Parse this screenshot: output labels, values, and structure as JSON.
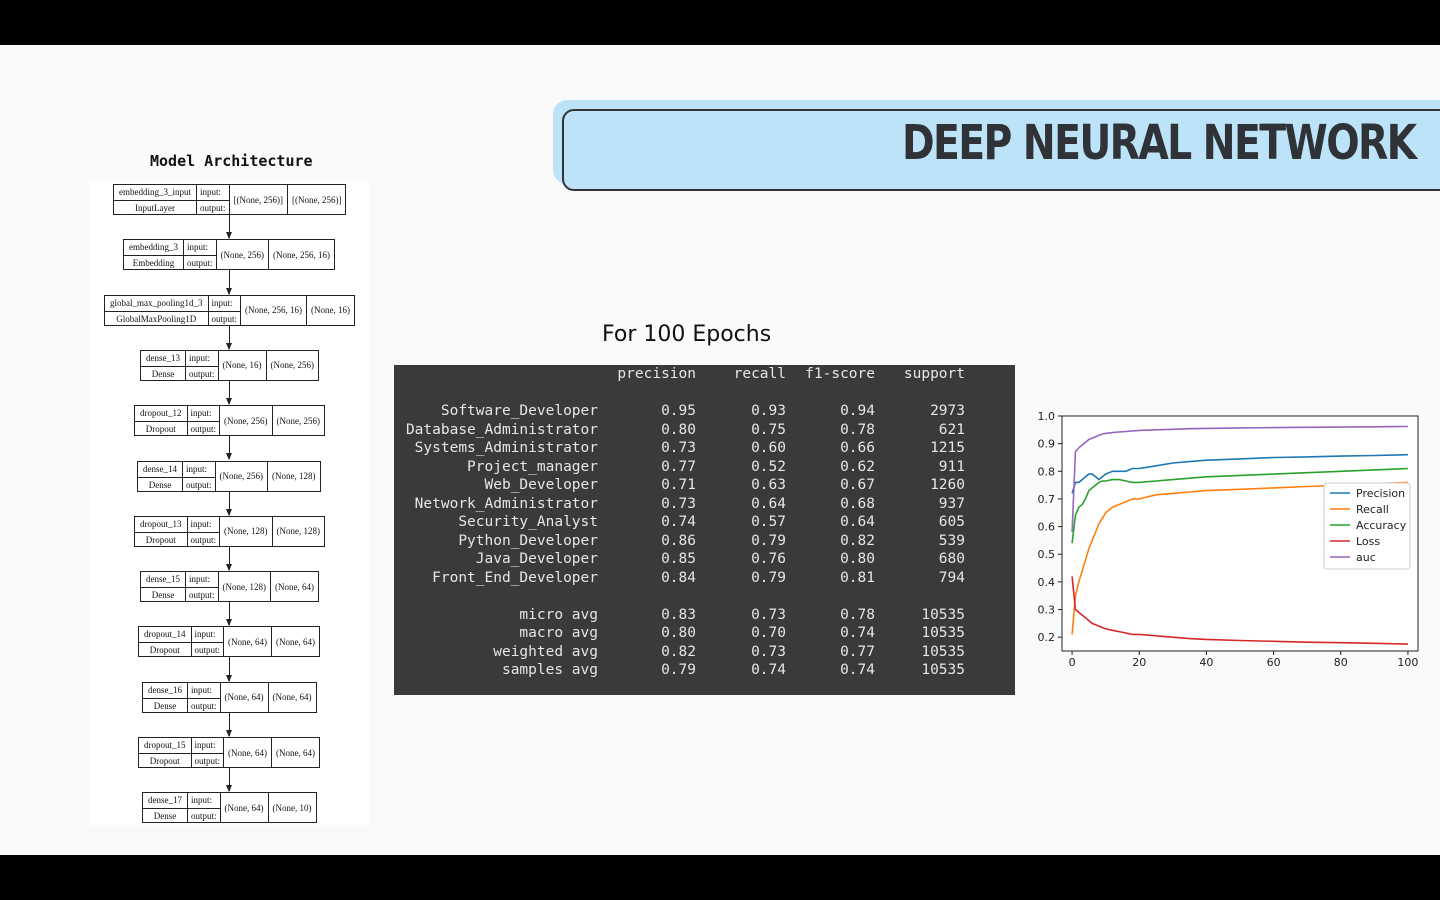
{
  "slide": {
    "title": "DEEP NEURAL NETWORK",
    "architecture_title": "Model Architecture",
    "epochs_title": "For 100 Epochs"
  },
  "architecture": {
    "layers": [
      {
        "name": "embedding_3_input",
        "type": "InputLayer",
        "in": "[(None, 256)]",
        "out": "[(None, 256)]"
      },
      {
        "name": "embedding_3",
        "type": "Embedding",
        "in": "(None, 256)",
        "out": "(None, 256, 16)"
      },
      {
        "name": "global_max_pooling1d_3",
        "type": "GlobalMaxPooling1D",
        "in": "(None, 256, 16)",
        "out": "(None, 16)"
      },
      {
        "name": "dense_13",
        "type": "Dense",
        "in": "(None, 16)",
        "out": "(None, 256)"
      },
      {
        "name": "dropout_12",
        "type": "Dropout",
        "in": "(None, 256)",
        "out": "(None, 256)"
      },
      {
        "name": "dense_14",
        "type": "Dense",
        "in": "(None, 256)",
        "out": "(None, 128)"
      },
      {
        "name": "dropout_13",
        "type": "Dropout",
        "in": "(None, 128)",
        "out": "(None, 128)"
      },
      {
        "name": "dense_15",
        "type": "Dense",
        "in": "(None, 128)",
        "out": "(None, 64)"
      },
      {
        "name": "dropout_14",
        "type": "Dropout",
        "in": "(None, 64)",
        "out": "(None, 64)"
      },
      {
        "name": "dense_16",
        "type": "Dense",
        "in": "(None, 64)",
        "out": "(None, 64)"
      },
      {
        "name": "dropout_15",
        "type": "Dropout",
        "in": "(None, 64)",
        "out": "(None, 64)"
      },
      {
        "name": "dense_17",
        "type": "Dense",
        "in": "(None, 64)",
        "out": "(None, 10)"
      }
    ],
    "input_label": "input:",
    "output_label": "output:"
  },
  "report": {
    "headers": [
      "precision",
      "recall",
      "f1-score",
      "support"
    ],
    "rows": [
      {
        "label": "Software_Developer",
        "p": "0.95",
        "r": "0.93",
        "f": "0.94",
        "s": "2973"
      },
      {
        "label": "Database_Administrator",
        "p": "0.80",
        "r": "0.75",
        "f": "0.78",
        "s": "621"
      },
      {
        "label": "Systems_Administrator",
        "p": "0.73",
        "r": "0.60",
        "f": "0.66",
        "s": "1215"
      },
      {
        "label": "Project_manager",
        "p": "0.77",
        "r": "0.52",
        "f": "0.62",
        "s": "911"
      },
      {
        "label": "Web_Developer",
        "p": "0.71",
        "r": "0.63",
        "f": "0.67",
        "s": "1260"
      },
      {
        "label": "Network_Administrator",
        "p": "0.73",
        "r": "0.64",
        "f": "0.68",
        "s": "937"
      },
      {
        "label": "Security_Analyst",
        "p": "0.74",
        "r": "0.57",
        "f": "0.64",
        "s": "605"
      },
      {
        "label": "Python_Developer",
        "p": "0.86",
        "r": "0.79",
        "f": "0.82",
        "s": "539"
      },
      {
        "label": "Java_Developer",
        "p": "0.85",
        "r": "0.76",
        "f": "0.80",
        "s": "680"
      },
      {
        "label": "Front_End_Developer",
        "p": "0.84",
        "r": "0.79",
        "f": "0.81",
        "s": "794"
      }
    ],
    "averages": [
      {
        "label": "micro avg",
        "p": "0.83",
        "r": "0.73",
        "f": "0.78",
        "s": "10535"
      },
      {
        "label": "macro avg",
        "p": "0.80",
        "r": "0.70",
        "f": "0.74",
        "s": "10535"
      },
      {
        "label": "weighted avg",
        "p": "0.82",
        "r": "0.73",
        "f": "0.77",
        "s": "10535"
      },
      {
        "label": "samples avg",
        "p": "0.79",
        "r": "0.74",
        "f": "0.74",
        "s": "10535"
      }
    ]
  },
  "chart_data": {
    "type": "line",
    "title": "",
    "xlabel": "",
    "ylabel": "",
    "xlim": [
      -3,
      103
    ],
    "ylim": [
      0.15,
      1.0
    ],
    "xticks": [
      0,
      20,
      40,
      60,
      80,
      100
    ],
    "yticks": [
      0.2,
      0.3,
      0.4,
      0.5,
      0.6,
      0.7,
      0.8,
      0.9,
      1.0
    ],
    "grid": false,
    "legend": "center-right",
    "x": [
      0,
      1,
      2,
      3,
      4,
      5,
      6,
      7,
      8,
      9,
      10,
      12,
      14,
      16,
      18,
      20,
      25,
      30,
      35,
      40,
      50,
      60,
      70,
      80,
      90,
      100
    ],
    "series": [
      {
        "name": "Precision",
        "color": "#1f77b4",
        "values": [
          0.72,
          0.76,
          0.76,
          0.77,
          0.78,
          0.79,
          0.79,
          0.78,
          0.77,
          0.78,
          0.79,
          0.8,
          0.8,
          0.8,
          0.81,
          0.81,
          0.82,
          0.83,
          0.835,
          0.84,
          0.845,
          0.85,
          0.852,
          0.855,
          0.857,
          0.86
        ]
      },
      {
        "name": "Recall",
        "color": "#ff7f0e",
        "values": [
          0.21,
          0.35,
          0.4,
          0.44,
          0.48,
          0.52,
          0.55,
          0.58,
          0.61,
          0.63,
          0.65,
          0.67,
          0.68,
          0.69,
          0.7,
          0.7,
          0.715,
          0.72,
          0.725,
          0.73,
          0.735,
          0.74,
          0.745,
          0.75,
          0.755,
          0.76
        ]
      },
      {
        "name": "Accuracy",
        "color": "#2ca02c",
        "values": [
          0.54,
          0.64,
          0.67,
          0.68,
          0.7,
          0.73,
          0.74,
          0.75,
          0.76,
          0.765,
          0.765,
          0.77,
          0.77,
          0.765,
          0.76,
          0.76,
          0.765,
          0.77,
          0.775,
          0.78,
          0.785,
          0.79,
          0.795,
          0.8,
          0.805,
          0.81
        ]
      },
      {
        "name": "Loss",
        "color": "#d62728",
        "values": [
          0.42,
          0.3,
          0.29,
          0.28,
          0.27,
          0.26,
          0.25,
          0.245,
          0.24,
          0.235,
          0.23,
          0.225,
          0.22,
          0.215,
          0.21,
          0.21,
          0.205,
          0.2,
          0.195,
          0.192,
          0.188,
          0.185,
          0.182,
          0.18,
          0.178,
          0.175
        ]
      },
      {
        "name": "auc",
        "color": "#9467bd",
        "values": [
          0.58,
          0.87,
          0.885,
          0.895,
          0.905,
          0.915,
          0.92,
          0.925,
          0.93,
          0.935,
          0.937,
          0.94,
          0.942,
          0.944,
          0.946,
          0.948,
          0.95,
          0.952,
          0.954,
          0.955,
          0.957,
          0.958,
          0.959,
          0.96,
          0.961,
          0.962
        ]
      }
    ]
  }
}
